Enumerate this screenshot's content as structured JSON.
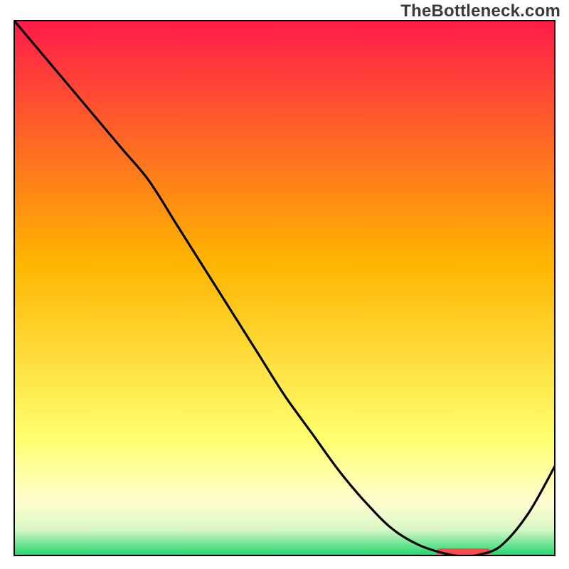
{
  "watermark": "TheBottleneck.com",
  "colors": {
    "frame": "#000000",
    "curve": "#000000",
    "redband": "#f74b4f",
    "gradient_top": "#ff1b4a",
    "gradient_mid": "#ffb400",
    "gradient_low": "#ffff6e",
    "gradient_cream": "#fffdd0",
    "gradient_pale": "#d9f7c7",
    "gradient_green": "#18d66a"
  },
  "chart_data": {
    "type": "line",
    "title": "",
    "xlabel": "",
    "ylabel": "",
    "xlim": [
      0,
      100
    ],
    "ylim": [
      0,
      100
    ],
    "series": [
      {
        "name": "bottleneck-curve",
        "x": [
          0,
          5,
          10,
          15,
          20,
          25,
          30,
          35,
          40,
          45,
          50,
          55,
          60,
          65,
          70,
          75,
          80,
          83,
          86,
          90,
          95,
          100
        ],
        "y": [
          100,
          94,
          88,
          82,
          76,
          70,
          62,
          54,
          46,
          38,
          30,
          23,
          16,
          10,
          5,
          2,
          0.4,
          0,
          0.3,
          2,
          8,
          17
        ]
      }
    ],
    "optimal_band": {
      "x_start": 78,
      "x_end": 88,
      "label": ""
    },
    "background_gradient": {
      "stops": [
        {
          "pos": 0.0,
          "color": "#ff1b4a"
        },
        {
          "pos": 0.45,
          "color": "#ffb400"
        },
        {
          "pos": 0.78,
          "color": "#ffff6e"
        },
        {
          "pos": 0.9,
          "color": "#fffdd0"
        },
        {
          "pos": 0.95,
          "color": "#d9f7c7"
        },
        {
          "pos": 1.0,
          "color": "#18d66a"
        }
      ]
    }
  }
}
